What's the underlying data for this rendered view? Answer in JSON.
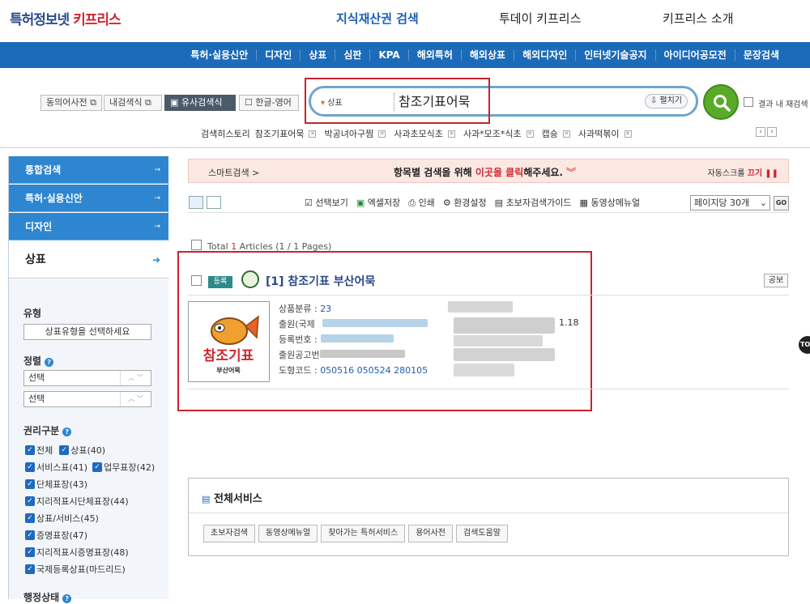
{
  "header": {
    "logo_part1": "특허정보넷",
    "logo_part2": "키프리스",
    "nav": [
      "지식재산권 검색",
      "투데이 키프리스",
      "키프리스 소개"
    ]
  },
  "menu": [
    "특허·실용신안",
    "디자인",
    "상표",
    "심판",
    "KPA",
    "해외특허",
    "해외상표",
    "해외디자인",
    "인터넷기술공지",
    "아이디어공모전",
    "문장검색"
  ],
  "search_options": {
    "synonym": "동의어사전",
    "inner": "내검색식",
    "similar": "유사검색식",
    "hanyoung": "한글-영어"
  },
  "search": {
    "category": "상표",
    "query": "참조기표어묵",
    "expand": "펼치기",
    "within_results": "결과 내 재검색"
  },
  "history": {
    "label": "검색히스토리",
    "items": [
      "참조기표어묵",
      "박공녀아구찜",
      "사과초모식초",
      "사과*모조*식초",
      "캡숑",
      "사과떡볶이"
    ]
  },
  "sidebar": {
    "items": [
      "통합검색",
      "특허·실용신안",
      "디자인"
    ],
    "current": "상표",
    "type_label": "유형",
    "type_select": "상표유형을 선택하세요",
    "sort_label": "정렬",
    "sort1": "선택",
    "sort2": "선택",
    "rights_label": "권리구분",
    "rights": [
      "전체",
      "상표(40)",
      "서비스표(41)",
      "업무표장(42)",
      "단체표장(43)",
      "지리적표시단체표장(44)",
      "상표/서비스(45)",
      "증명표장(47)",
      "지리적표시증명표장(48)",
      "국제등록상표(마드리드)"
    ],
    "status_label": "행정상태"
  },
  "smart_bar": {
    "left": "스마트검색 >",
    "mid_pre": "항목별 검색을 위해 ",
    "mid_link": "이곳을 클릭",
    "mid_post": "해주세요.",
    "auto_scroll": "자동스크롤",
    "off": "끄기"
  },
  "tools": [
    "선택보기",
    "엑셀저장",
    "인쇄",
    "환경설정",
    "초보자검색가이드",
    "동영상메뉴얼"
  ],
  "per_page": "페이지당 30개",
  "go": "GO",
  "total": {
    "prefix": "Total ",
    "count": "1",
    "suffix": " Articles (1 / 1 Pages)"
  },
  "result": {
    "badge": "등록",
    "title": "[1] 참조기표 부산어묵",
    "gongbo": "공보",
    "thumb_text_main": "참조기표",
    "thumb_text_sub": "부산어묵",
    "class_label": "상품분류 : ",
    "class_value": "23",
    "app_label": "출원(국제",
    "reg_label": "등록번호 : ",
    "pub_label": "출원공고번",
    "fig_label": "도형코드 : ",
    "fig_value": "050516 050524 280105",
    "partial_value": "1.18"
  },
  "services": {
    "title": "전체서비스",
    "buttons": [
      "초보자검색",
      "동영상메뉴얼",
      "찾아가는 특허서비스",
      "용어사전",
      "검색도움말"
    ]
  },
  "top_button": "TOP",
  "colors": {
    "blue_bar": "#1b6bb8",
    "sidebar_blue": "#2e86d0",
    "highlight_red": "#c8232c",
    "search_green": "#5aaa2a"
  }
}
